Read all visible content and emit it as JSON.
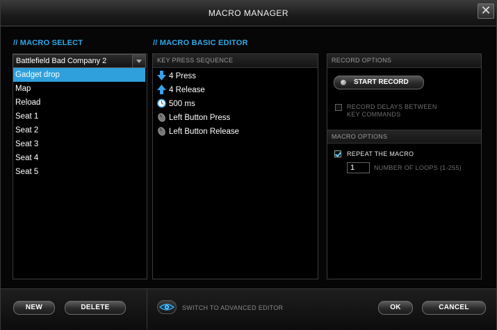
{
  "window": {
    "title": "MACRO MANAGER",
    "close_glyph": "✕"
  },
  "sections": {
    "macro_select": "// MACRO SELECT",
    "basic_editor": "// MACRO BASIC EDITOR"
  },
  "game_select": {
    "selected": "Battlefield Bad Company 2"
  },
  "macros": [
    {
      "label": "Gadget drop",
      "selected": true
    },
    {
      "label": "Map"
    },
    {
      "label": "Reload"
    },
    {
      "label": "Seat 1"
    },
    {
      "label": "Seat 2"
    },
    {
      "label": "Seat 3"
    },
    {
      "label": "Seat 4"
    },
    {
      "label": "Seat 5"
    }
  ],
  "sequence": {
    "header": "KEY PRESS SEQUENCE",
    "items": [
      {
        "label": "4 Press",
        "icon": "arrow-down-icon"
      },
      {
        "label": "4 Release",
        "icon": "arrow-up-icon"
      },
      {
        "label": "500 ms",
        "icon": "clock-icon"
      },
      {
        "label": "Left Button Press",
        "icon": "mouse-icon"
      },
      {
        "label": "Left Button Release",
        "icon": "mouse-icon"
      }
    ]
  },
  "record_options": {
    "header": "RECORD OPTIONS",
    "start_record": "START RECORD",
    "record_delays_line1": "RECORD DELAYS BETWEEN",
    "record_delays_line2": "KEY COMMANDS",
    "record_delays_checked": false
  },
  "macro_options": {
    "header": "MACRO OPTIONS",
    "repeat_label": "REPEAT THE MACRO",
    "repeat_checked": true,
    "loops_value": "1",
    "loops_label": "NUMBER OF LOOPS (1-255)"
  },
  "footer": {
    "new": "NEW",
    "delete": "DELETE",
    "advanced": "SWITCH TO ADVANCED EDITOR",
    "ok": "OK",
    "cancel": "CANCEL"
  },
  "colors": {
    "accent": "#2fa9e8",
    "selection": "#2fa0dc",
    "arrow_icon": "#3aa0e8"
  }
}
